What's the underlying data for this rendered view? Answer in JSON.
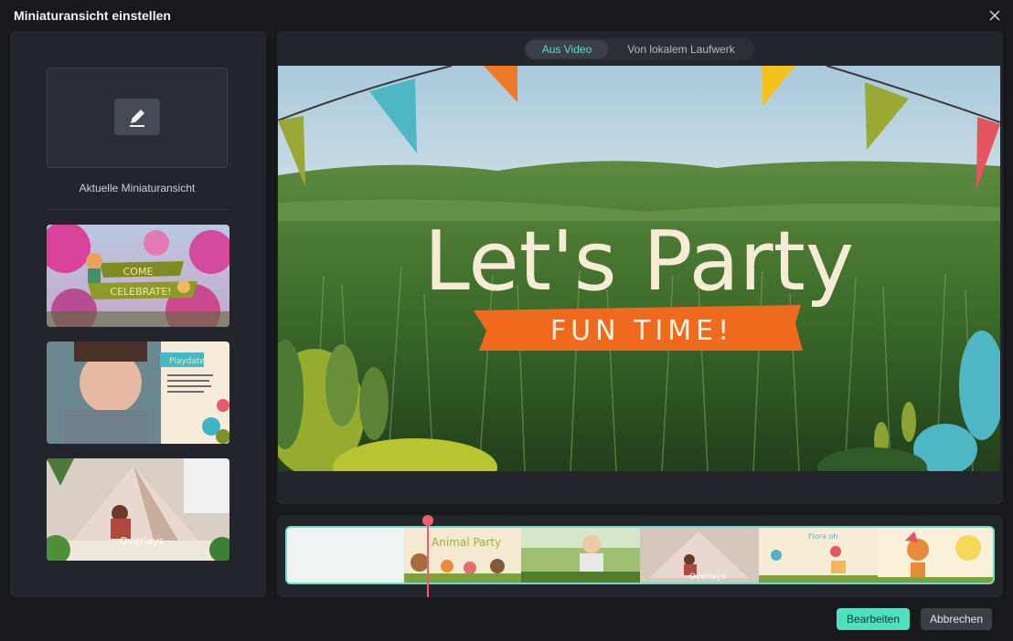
{
  "dialog": {
    "title": "Miniaturansicht einstellen"
  },
  "icons": {
    "close": "close-icon",
    "edit": "pencil-icon"
  },
  "left_panel": {
    "current_label": "Aktuelle Miniaturansicht",
    "templates": [
      {
        "name": "come-celebrate",
        "text_lines": [
          "COME",
          "CELEBRATE!"
        ]
      },
      {
        "name": "playdate",
        "text_lines": [
          "Playdate"
        ]
      },
      {
        "name": "overlays",
        "text_lines": [
          "Overlays"
        ]
      }
    ]
  },
  "source_tabs": {
    "selected": "Aus Video",
    "other": "Von lokalem Laufwerk"
  },
  "preview": {
    "headline": "Let's Party",
    "banner": "FUN TIME!"
  },
  "timeline": {
    "frame_texts": [
      "Animal Party",
      "Overlays",
      "Flora oh"
    ]
  },
  "footer": {
    "primary_label": "Bearbeiten",
    "secondary_label": "Abbrechen"
  },
  "colors": {
    "accent": "#4fe0c0",
    "playhead": "#ef5b6b",
    "banner": "#f06a1e"
  }
}
